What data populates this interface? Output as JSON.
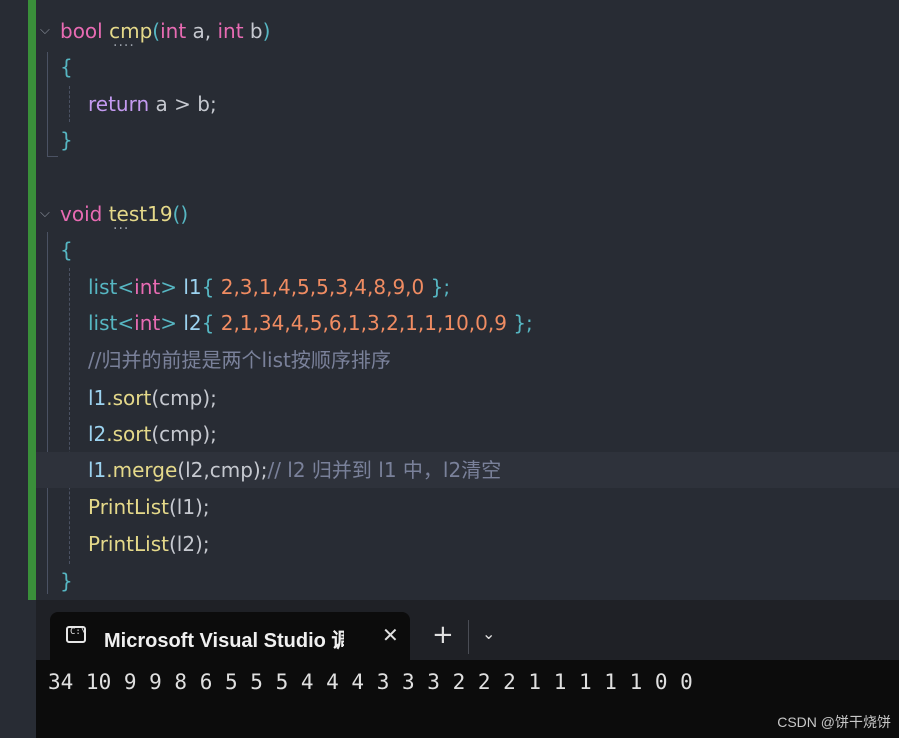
{
  "code": {
    "cmp": {
      "kw_bool": "bool",
      "name": "cmp",
      "paren_open": "(",
      "kw_int1": "int",
      "param_a": " a, ",
      "kw_int2": "int",
      "param_b": " b",
      "paren_close": ")",
      "brace_open": "{",
      "kw_return": "return",
      "expr": " a > b;",
      "brace_close": "}"
    },
    "test19": {
      "kw_void": "void",
      "name": "test19",
      "parens": "()",
      "brace_open": "{",
      "l1_type": "list",
      "l1_lt": "<",
      "l1_int": "int",
      "l1_gt": ">",
      "l1_var": "l1",
      "l1_open": "{ ",
      "l1_values": "2,3,1,4,5,5,3,4,8,9,0",
      "l1_close": " };",
      "l2_type": "list",
      "l2_lt": "<",
      "l2_int": "int",
      "l2_gt": ">",
      "l2_var": "l2",
      "l2_open": "{ ",
      "l2_values": "2,1,34,4,5,6,1,3,2,1,1,10,0,9",
      "l2_close": " };",
      "comment": "//归并的前提是两个list按顺序排序",
      "sort1_var": "l1",
      "sort1_call": ".sort",
      "sort1_args": "(cmp);",
      "sort2_var": "l2",
      "sort2_call": ".sort",
      "sort2_args": "(cmp);",
      "merge_var": "l1",
      "merge_call": ".merge",
      "merge_args": "(l2,cmp);",
      "merge_comment": "// l2 归并到 l1 中，l2清空",
      "print1_fn": "PrintList",
      "print1_args": "(l1);",
      "print2_fn": "PrintList",
      "print2_args": "(l2);",
      "brace_close": "}"
    }
  },
  "terminal": {
    "tab_title": "Microsoft Visual Studio 调",
    "tab_icon_text": "C:\\",
    "close_glyph": "✕",
    "new_tab_glyph": "+",
    "dropdown_glyph": "⌄",
    "output": "34 10 9 9 8 6 5 5 5 4 4 4 3 3 3 2 2 2 1 1 1 1 1 0 0"
  },
  "watermark": "CSDN @饼干烧饼",
  "colors": {
    "editor_bg": "#282c34",
    "gutter_accent": "#3a8f3a",
    "terminal_bg": "#0c0c0c"
  }
}
